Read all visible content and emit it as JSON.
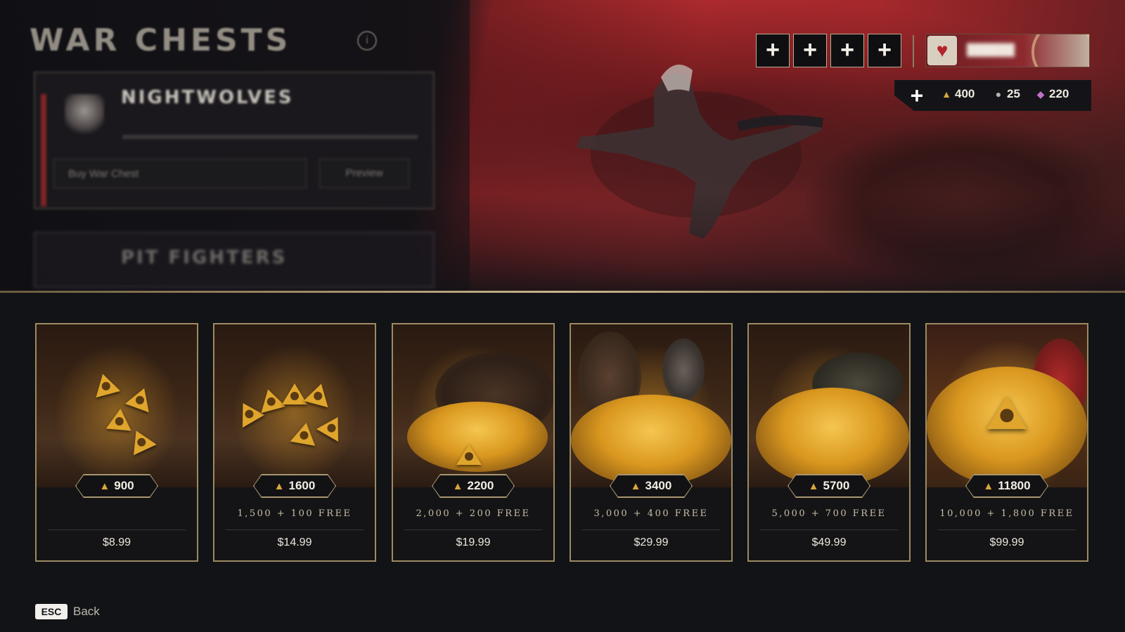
{
  "header": {
    "title": "WAR CHESTS",
    "info_icon": "info-icon"
  },
  "war_chest": {
    "name": "NIGHTWOLVES",
    "buy_label": "Buy War Chest",
    "preview_label": "Preview",
    "next_name": "PIT FIGHTERS"
  },
  "hud": {
    "plus_slots": [
      "+",
      "+",
      "+",
      "+"
    ],
    "currencies": {
      "add_label": "+",
      "gold": "400",
      "silver": "25",
      "gems": "220"
    },
    "colors": {
      "gold": "#d8a63c",
      "silver": "#b6b4b0",
      "gem": "#c070c8",
      "accent": "#9c8a62"
    }
  },
  "packs": [
    {
      "amount": "900",
      "bonus": "",
      "price": "$8.99"
    },
    {
      "amount": "1600",
      "bonus": "1,500 + 100 FREE",
      "price": "$14.99"
    },
    {
      "amount": "2200",
      "bonus": "2,000 + 200 FREE",
      "price": "$19.99"
    },
    {
      "amount": "3400",
      "bonus": "3,000 + 400 FREE",
      "price": "$29.99"
    },
    {
      "amount": "5700",
      "bonus": "5,000 + 700 FREE",
      "price": "$49.99"
    },
    {
      "amount": "11800",
      "bonus": "10,000 + 1,800 FREE",
      "price": "$99.99"
    }
  ],
  "footer": {
    "esc_key": "ESC",
    "back_label": "Back"
  }
}
